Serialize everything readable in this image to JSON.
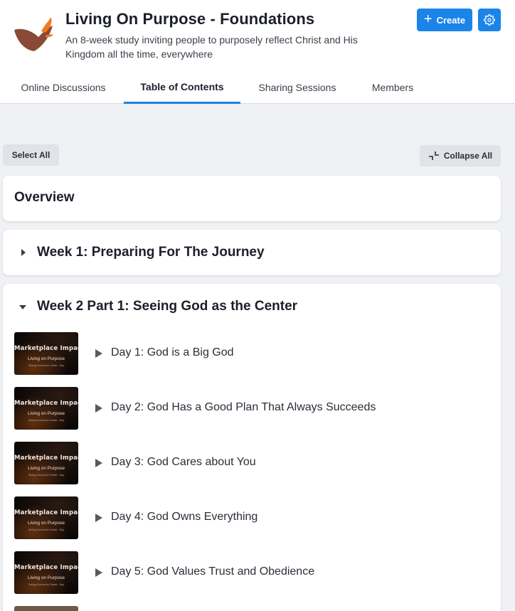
{
  "header": {
    "title": "Living On Purpose - Foundations",
    "description": "An 8-week study inviting people to purposely reflect Christ and His Kingdom all the time, everywhere",
    "create_label": "Create"
  },
  "tabs": [
    {
      "label": "Online Discussions",
      "active": false
    },
    {
      "label": "Table of Contents",
      "active": true
    },
    {
      "label": "Sharing Sessions",
      "active": false
    },
    {
      "label": "Members",
      "active": false
    }
  ],
  "toolbar": {
    "select_all_label": "Select All",
    "collapse_all_label": "Collapse All"
  },
  "sections": [
    {
      "title": "Overview",
      "expanded": false
    },
    {
      "title": "Week 1: Preparing For The Journey",
      "expanded": false
    },
    {
      "title": "Week 2 Part 1: Seeing God as the Center",
      "expanded": true
    }
  ],
  "lessons": [
    {
      "label": "Day 1: God is a Big God"
    },
    {
      "label": "Day 2: God Has a Good Plan That Always Succeeds"
    },
    {
      "label": "Day 3: God Cares about You"
    },
    {
      "label": "Day 4: God Owns Everything"
    },
    {
      "label": "Day 5: God Values Trust and Obedience"
    }
  ],
  "thumbnail": {
    "heading": "Marketplace Impact",
    "subheading": "Living on Purpose",
    "caption": "Seeing God as the Center - Day"
  },
  "colors": {
    "accent": "#1a84e8",
    "logo_brown": "#8a4a35",
    "logo_orange": "#f07a1a"
  },
  "icons": {
    "create": "plus-icon",
    "settings": "gear-icon",
    "collapse": "collapse-icon",
    "collapsed_section": "caret-right-icon",
    "expanded_section": "caret-down-icon",
    "lesson": "play-icon"
  }
}
